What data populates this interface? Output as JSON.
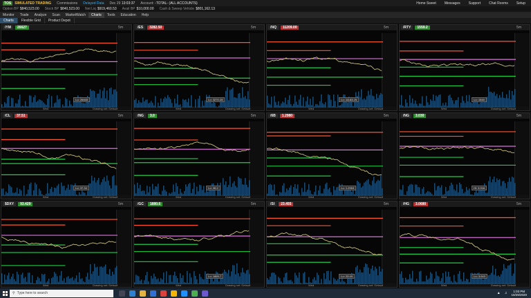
{
  "topbar": {
    "logo": "TOS",
    "mode": "SIMULATED TRADING",
    "commission_label": "Commissions",
    "day_pl_label": "Day P/L",
    "dcpl_label": "Delayed Data",
    "time_label": "Dec 29",
    "time_value": "13:03:37",
    "account_label": "Account:",
    "account_value": "-TOTAL- (ALL ACCOUNTS)",
    "right": [
      "Home Sweet",
      "Messages",
      "Support",
      "Chat Rooms",
      "Setup"
    ]
  },
  "account_bar": [
    {
      "label": "Option BP",
      "value": "$840,523.00"
    },
    {
      "label": "Stock BP",
      "value": "$840,523.00"
    },
    {
      "label": "Net Liq",
      "value": "$919,460.53"
    },
    {
      "label": "Avail BP",
      "value": "$10,000.00"
    },
    {
      "label": "Cash & Sweep Vehicle",
      "value": "$801,162.13"
    }
  ],
  "menu": [
    "Monitor",
    "Trade",
    "Analyze",
    "Scan",
    "MarketWatch",
    "Charts",
    "Tools",
    "Education",
    "Help"
  ],
  "menu_active": "Charts",
  "subtabs": [
    "Charts",
    "Flexible Grid",
    "Product Depot"
  ],
  "subtab_active": "Charts",
  "panels": [
    {
      "sym": "/YM",
      "price": "26627",
      "dir": "up",
      "tf": "5m",
      "footer": "Wed",
      "drawing": "Drawing set: Default",
      "lo": "Lo: 26465"
    },
    {
      "sym": "/ES",
      "price": "3282.50",
      "dir": "down",
      "tf": "5m",
      "footer": "Wed",
      "drawing": "Drawing set: Default",
      "lo": "Lo: 3270.25"
    },
    {
      "sym": "/NQ",
      "price": "11209.00",
      "dir": "down",
      "tf": "5m",
      "footer": "Wed",
      "drawing": "Drawing set: Default",
      "lo": "Lo: 11183.25"
    },
    {
      "sym": "/RTY",
      "price": "1559.2",
      "dir": "up",
      "tf": "5m",
      "footer": "Wed",
      "drawing": "Drawing set: Default",
      "lo": "Lo: 1548"
    },
    {
      "sym": "/CL",
      "price": "37.51",
      "dir": "down",
      "tf": "5m",
      "footer": "Wed",
      "drawing": "Drawing set: Default",
      "lo": "Lo: 37.34"
    },
    {
      "sym": "/NG",
      "price": "3.0",
      "dir": "up",
      "tf": "5m",
      "footer": "Wed",
      "drawing": "Drawing set: Default",
      "lo": "Lo: 30.2"
    },
    {
      "sym": "/6B",
      "price": "1.2980",
      "dir": "down",
      "tf": "5m",
      "footer": "Wed",
      "drawing": "Drawing set: Default",
      "lo": "Lo: 1.2963"
    },
    {
      "sym": "/NG",
      "price": "3.030",
      "dir": "up",
      "tf": "5m",
      "footer": "Wed",
      "drawing": "Drawing set: Default",
      "lo": "Hi: 3.016"
    },
    {
      "sym": "$DXY",
      "price": "93.429",
      "dir": "up",
      "tf": "5m",
      "footer": "Wed",
      "drawing": "Drawing set: Default",
      "lo": ""
    },
    {
      "sym": "/GC",
      "price": "1880.6",
      "dir": "up",
      "tf": "5m",
      "footer": "Wed",
      "drawing": "Drawing set: Default",
      "lo": "Lo: 1865.7"
    },
    {
      "sym": "/SI",
      "price": "23.455",
      "dir": "down",
      "tf": "5m",
      "footer": "Wed",
      "drawing": "Drawing set: Default",
      "lo": "Lo: 23.49"
    },
    {
      "sym": "/HG",
      "price": "3.0680",
      "dir": "down",
      "tf": "5m",
      "footer": "Wed",
      "drawing": "Drawing set: Default",
      "lo": "Lo: 3.043"
    }
  ],
  "taskbar": {
    "search_placeholder": "Type here to search",
    "time": "1:03 PM",
    "date": "10/29/2020"
  },
  "colors": {
    "up": "#2f8f2f",
    "down": "#b73232",
    "price_line": "#c9c07a",
    "green_level": "#22cc44",
    "red_level": "#ff5533",
    "magenta_level": "#e070e0",
    "volume": "#2a6fa8"
  }
}
